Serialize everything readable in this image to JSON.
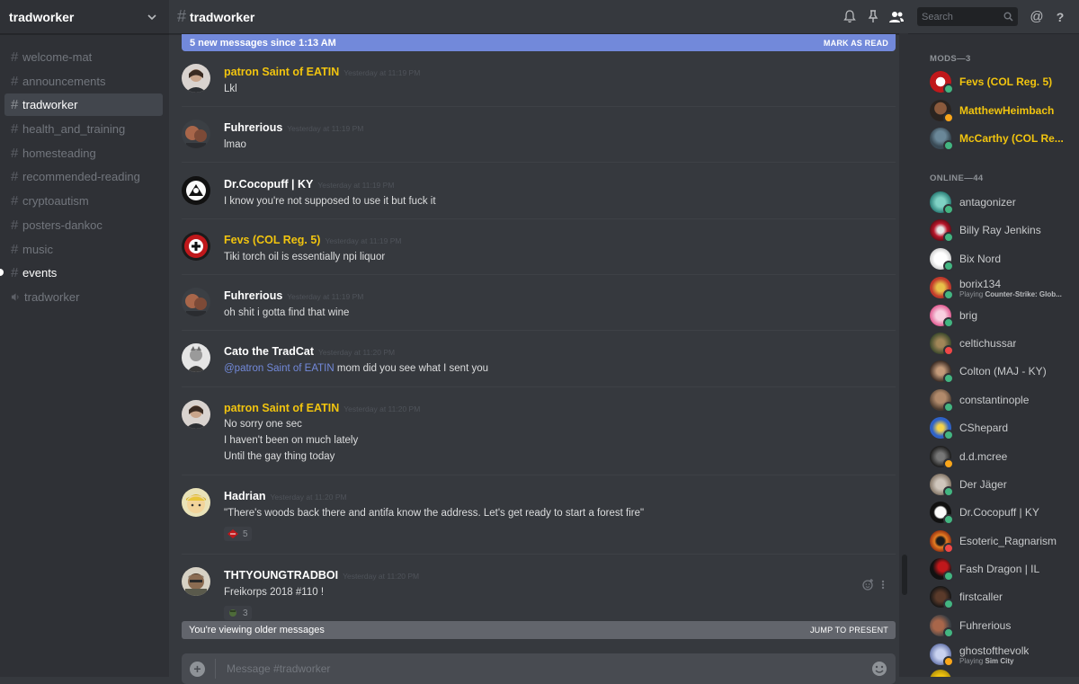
{
  "guild": {
    "name": "tradworker"
  },
  "channels": [
    {
      "name": "welcome-mat"
    },
    {
      "name": "announcements"
    },
    {
      "name": "tradworker"
    },
    {
      "name": "health_and_training"
    },
    {
      "name": "homesteading"
    },
    {
      "name": "recommended-reading"
    },
    {
      "name": "cryptoautism"
    },
    {
      "name": "posters-dankoc"
    },
    {
      "name": "music"
    },
    {
      "name": "events"
    },
    {
      "name": "tradworker"
    }
  ],
  "header": {
    "channel": "tradworker",
    "search_placeholder": "Search"
  },
  "new_messages_bar": {
    "text": "5 new messages since 1:13 AM",
    "action": "MARK AS READ"
  },
  "messages": [
    {
      "author": "patron Saint of EATIN",
      "time": "Yesterday at 11:19 PM",
      "lines": [
        "Lkl"
      ]
    },
    {
      "author": "Fuhrerious",
      "time": "Yesterday at 11:19 PM",
      "lines": [
        "lmao"
      ]
    },
    {
      "author": "Dr.Cocopuff | KY",
      "time": "Yesterday at 11:19 PM",
      "lines": [
        "I know you're not supposed to use it but fuck it"
      ]
    },
    {
      "author": "Fevs (COL Reg. 5)",
      "time": "Yesterday at 11:19 PM",
      "lines": [
        "Tiki torch oil is essentially npi liquor"
      ]
    },
    {
      "author": "Fuhrerious",
      "time": "Yesterday at 11:19 PM",
      "lines": [
        "oh shit i gotta find that wine"
      ]
    },
    {
      "author": "Cato the TradCat",
      "time": "Yesterday at 11:20 PM",
      "mention": "@patron Saint of EATIN",
      "lines": [
        " mom did you see what I sent you"
      ]
    },
    {
      "author": "patron Saint of EATIN",
      "time": "Yesterday at 11:20 PM",
      "lines": [
        "No sorry one sec",
        "I haven't been on much lately",
        "Until the gay thing today"
      ]
    },
    {
      "author": "Hadrian",
      "time": "Yesterday at 11:20 PM",
      "lines": [
        "\"There's woods back there and antifa know the address. Let's get ready to start a forest fire\""
      ],
      "reaction_count": "5"
    },
    {
      "author": "THTYOUNGTRADBOI",
      "time": "Yesterday at 11:20 PM",
      "lines": [
        "Freikorps 2018 #110 !"
      ],
      "reaction_count": "3"
    }
  ],
  "older_bar": {
    "text": "You're viewing older messages",
    "action": "JUMP TO PRESENT"
  },
  "composer": {
    "placeholder": "Message #tradworker"
  },
  "members": {
    "mods_header": "MODS—3",
    "online_header": "ONLINE—44",
    "mods": [
      {
        "name": "Fevs (COL Reg. 5)"
      },
      {
        "name": "MatthewHeimbach"
      },
      {
        "name": "McCarthy (COL Re..."
      }
    ],
    "online": [
      {
        "name": "antagonizer"
      },
      {
        "name": "Billy Ray Jenkins"
      },
      {
        "name": "Bix Nord"
      },
      {
        "name": "borix134",
        "activity": "Playing",
        "game": "Counter-Strike: Glob..."
      },
      {
        "name": "brig"
      },
      {
        "name": "celtichussar"
      },
      {
        "name": "Colton (MAJ - KY)"
      },
      {
        "name": "constantinople"
      },
      {
        "name": "CShepard"
      },
      {
        "name": "d.d.mcree"
      },
      {
        "name": "Der Jäger"
      },
      {
        "name": "Dr.Cocopuff | KY"
      },
      {
        "name": "Esoteric_Ragnarism"
      },
      {
        "name": "Fash Dragon | IL"
      },
      {
        "name": "firstcaller"
      },
      {
        "name": "Fuhrerious"
      },
      {
        "name": "ghostofthevolk",
        "activity": "Playing",
        "game": "Sim City"
      }
    ]
  },
  "colors": {
    "accent": "#7289da",
    "mod_gold": "#f1c40f",
    "online": "#43b581",
    "idle": "#faa61a",
    "dnd": "#f04747"
  }
}
